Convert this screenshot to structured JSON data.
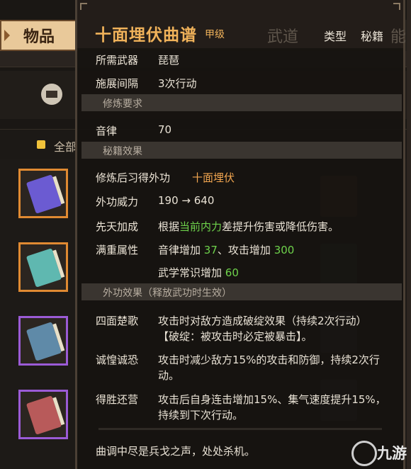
{
  "background": {
    "main_tab": "物品",
    "filter_all": "全部",
    "colors": {
      "tab_bg": "#e9c99a",
      "slot_orange": "#e08a32",
      "slot_purple": "#9b5bd6",
      "filter_dot": "#f0c23a"
    },
    "slots": [
      {
        "rarity": "orange",
        "book_color": "#6b5bd2"
      },
      {
        "rarity": "orange",
        "book_color": "#5fb8b0"
      },
      {
        "rarity": "purple",
        "book_color": "#5f8aa8"
      },
      {
        "rarity": "purple",
        "book_color": "#b85a5a"
      }
    ]
  },
  "tooltip": {
    "title": "十面埋伏曲谱",
    "grade": "甲级",
    "bg_tab_label": "武道",
    "bg_tab_label2": "能",
    "type_key": "类型",
    "type_value": "秘籍",
    "weapon_key": "所需武器",
    "weapon_value": "琵琶",
    "interval_key": "施展间隔",
    "interval_value": "3次行动",
    "section_requirements": "修炼要求",
    "music_key": "音律",
    "music_value": "70",
    "section_effects": "秘籍效果",
    "learn_key": "修炼后习得外功",
    "learn_value": "十面埋伏",
    "power_key": "外功威力",
    "power_value": "190 → 640",
    "innate_key": "先天加成",
    "innate_pre": "根据",
    "innate_highlight": "当前内力",
    "innate_post": "差提升伤害或降低伤害。",
    "full_key": "满重属性",
    "full_line1_a": "音律增加",
    "full_line1_b": "37",
    "full_line1_c": "、攻击增加",
    "full_line1_d": "300",
    "full_line2_a": "武学常识增加",
    "full_line2_b": "60",
    "section_external": "外功效果（释放武功时生效）",
    "effects": [
      {
        "name": "四面楚歌",
        "line1": "攻击时对敌方造成破绽效果（持续2次行动）",
        "line2": "【破绽：被攻击时必定被暴击】。"
      },
      {
        "name": "诚惶诚恐",
        "line1": "攻击时减少敌方15%的攻击和防御，持续2次行",
        "line2": "动。"
      },
      {
        "name": "得胜还营",
        "line1": "攻击后自身连击增加15%、集气速度提升15%，",
        "line2": "持续到下次行动。"
      }
    ],
    "flavor": "曲调中尽是兵戈之声，处处杀机。",
    "colors": {
      "title": "#f0b25a",
      "highlight": "#f2a650",
      "positive": "#6ed24b",
      "section_bg": "#3a3530"
    }
  },
  "watermark": "九游"
}
